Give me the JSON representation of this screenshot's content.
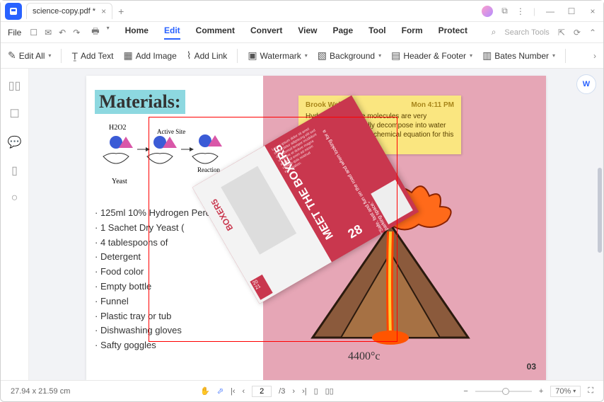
{
  "titlebar": {
    "filename": "science-copy.pdf *"
  },
  "menubar": {
    "file": "File",
    "tabs": [
      "Home",
      "Edit",
      "Comment",
      "Convert",
      "View",
      "Page",
      "Tool",
      "Form",
      "Protect"
    ],
    "active": "Edit",
    "search_placeholder": "Search Tools"
  },
  "toolbar": {
    "edit_all": "Edit All",
    "add_text": "Add Text",
    "add_image": "Add Image",
    "add_link": "Add Link",
    "watermark": "Watermark",
    "background": "Background",
    "header_footer": "Header & Footer",
    "bates_number": "Bates Number"
  },
  "document": {
    "materials_title": "Materials:",
    "h2o2_label": "H2O2",
    "active_site": "Active Site",
    "yeast": "Yeast",
    "reaction": "Reaction",
    "materials_list": [
      "125ml 10% Hydrogen Peroxide",
      "1 Sachet Dry Yeast (",
      "4 tablespoons of",
      "Detergent",
      "Food color",
      "Empty bottle",
      "Funnel",
      "Plastic tray or tub",
      "Dishwashing gloves",
      "Safty goggles"
    ],
    "sticky": {
      "author": "Brook Wells",
      "time": "Mon 4:11 PM",
      "body": "Hydrogen peroxide molecules are very unstable and naturally decompose into water and oxygen gas. The chemical equation for this decompostion is:"
    },
    "flyer": {
      "title": "MEET THE BOXER5",
      "quote": "\"Safe, fast and fun on the road and when looking for a parking space.\"",
      "big_num": "28",
      "side": "BOXER5",
      "year": "20 21"
    },
    "temperature": "4400°c",
    "page_number": "03"
  },
  "statusbar": {
    "dimensions": "27.94 x 21.59 cm",
    "current_page": "2",
    "total_pages": "/3",
    "zoom": "70%"
  }
}
